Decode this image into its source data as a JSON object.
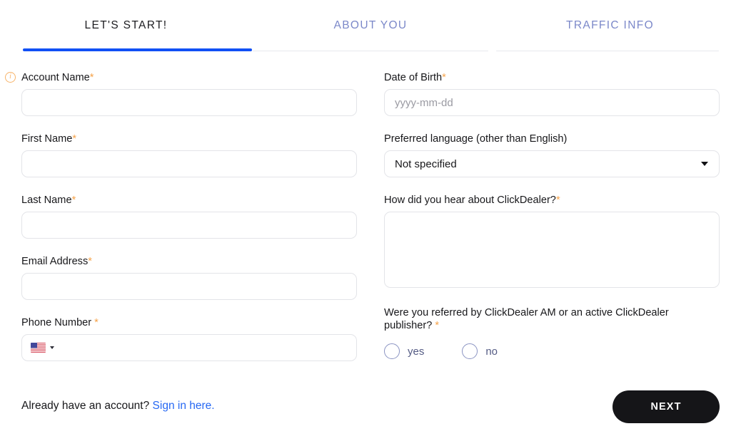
{
  "tabs": [
    {
      "label": "LET'S START!",
      "state": "active"
    },
    {
      "label": "ABOUT YOU",
      "state": "inactive"
    },
    {
      "label": "TRAFFIC INFO",
      "state": "inactive"
    }
  ],
  "colors": {
    "active_tab_underline": "#1150f5",
    "inactive_tab_text": "#7b88c9",
    "required_asterisk": "#f6a34a",
    "info_icon": "#f7b368",
    "link": "#2668f3",
    "next_button_bg": "#151518",
    "radio_border": "#8a93c2",
    "radio_label": "#545b84",
    "input_border": "#e3e4e8",
    "placeholder": "#9a9aa2"
  },
  "left_column": {
    "account_name": {
      "label": "Account Name",
      "required_mark": "*",
      "info_icon_glyph": "i",
      "value": "",
      "placeholder": ""
    },
    "first_name": {
      "label": "First Name",
      "required_mark": "*",
      "value": "",
      "placeholder": ""
    },
    "last_name": {
      "label": "Last Name",
      "required_mark": "*",
      "value": "",
      "placeholder": ""
    },
    "email_address": {
      "label": "Email Address",
      "required_mark": "*",
      "value": "",
      "placeholder": ""
    },
    "phone_number": {
      "label": "Phone Number",
      "required_mark": "*",
      "country_flag": "us-flag-icon",
      "value": "",
      "placeholder": ""
    }
  },
  "right_column": {
    "date_of_birth": {
      "label": "Date of Birth",
      "required_mark": "*",
      "value": "",
      "placeholder": "yyyy-mm-dd"
    },
    "preferred_language": {
      "label": "Preferred language (other than English)",
      "required_mark": "",
      "selected": "Not specified",
      "options": [
        "Not specified"
      ]
    },
    "how_did_you_hear": {
      "label": "How did you hear about ClickDealer?",
      "required_mark": "*",
      "value": "",
      "placeholder": ""
    },
    "referred": {
      "label": "Were you referred by ClickDealer AM or an active ClickDealer publisher?",
      "required_mark": "*",
      "options": [
        {
          "label": "yes",
          "value": "yes",
          "selected": false
        },
        {
          "label": "no",
          "value": "no",
          "selected": false
        }
      ]
    }
  },
  "footer": {
    "signin_prompt": "Already have an account?",
    "signin_link": "Sign in here.",
    "next_label": "NEXT"
  }
}
